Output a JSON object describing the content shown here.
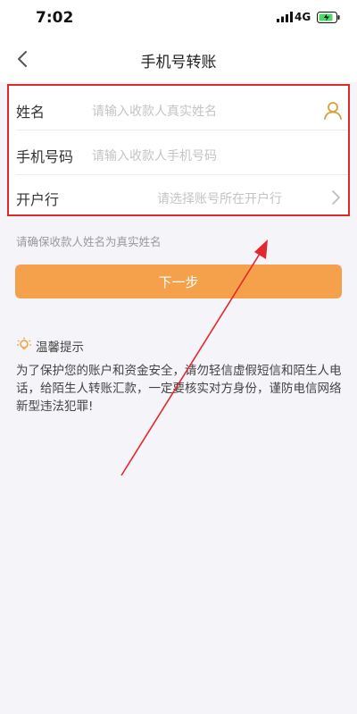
{
  "status_bar": {
    "time": "7:02",
    "network": "4G"
  },
  "navbar": {
    "title": "手机号转账"
  },
  "form": {
    "name": {
      "label": "姓名",
      "placeholder": "请输入收款人真实姓名"
    },
    "phone": {
      "label": "手机号码",
      "placeholder": "请输入收款人手机号码"
    },
    "bank": {
      "label": "开户行",
      "placeholder": "请选择账号所在开户行"
    }
  },
  "hint": "请确保收款人姓名为真实姓名",
  "next_button": "下一步",
  "tips": {
    "title": "温馨提示",
    "body": "为了保护您的账户和资金安全，请勿轻信虚假短信和陌生人电话，给陌生人转账汇款，一定要核实对方身份，谨防电信网络新型违法犯罪!"
  },
  "colors": {
    "accent": "#f5a04a",
    "annotation": "#e3272e"
  }
}
